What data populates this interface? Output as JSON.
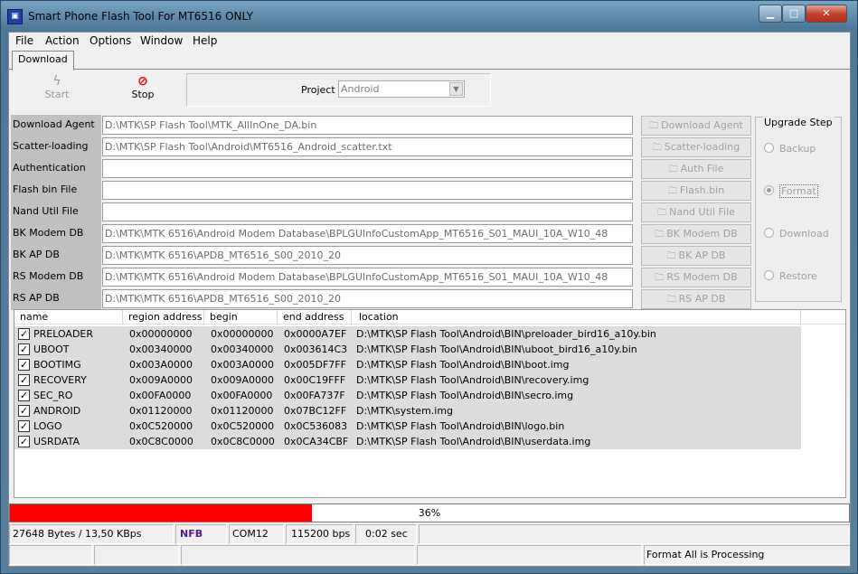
{
  "window": {
    "title": "Smart Phone Flash Tool For MT6516 ONLY",
    "min": "▁",
    "max": "□",
    "close": "✕"
  },
  "menu": [
    "File",
    "Action",
    "Options",
    "Window",
    "Help"
  ],
  "tabs": {
    "download": "Download"
  },
  "toolbar": {
    "start": "Start",
    "stop": "Stop",
    "project_label": "Project",
    "project_value": "Android"
  },
  "fields": [
    {
      "label": "Download Agent",
      "value": "D:\\MTK\\SP Flash Tool\\MTK_AllInOne_DA.bin",
      "button": "Download Agent"
    },
    {
      "label": "Scatter-loading File",
      "value": "D:\\MTK\\SP Flash Tool\\Android\\MT6516_Android_scatter.txt",
      "button": "Scatter-loading"
    },
    {
      "label": "Authentication File",
      "value": "",
      "button": "Auth File"
    },
    {
      "label": "Flash bin File",
      "value": "",
      "button": "Flash.bin"
    },
    {
      "label": "Nand Util File",
      "value": "",
      "button": "Nand Util File"
    },
    {
      "label": "BK Modem DB",
      "value": "D:\\MTK\\MTK 6516\\Android Modem Database\\BPLGUInfoCustomApp_MT6516_S01_MAUI_10A_W10_48",
      "button": "BK Modem DB"
    },
    {
      "label": "BK AP DB",
      "value": "D:\\MTK\\MTK 6516\\APDB_MT6516_S00_2010_20",
      "button": "BK AP DB"
    },
    {
      "label": "RS Modem DB",
      "value": "D:\\MTK\\MTK 6516\\Android Modem Database\\BPLGUInfoCustomApp_MT6516_S01_MAUI_10A_W10_48",
      "button": "RS Modem DB"
    },
    {
      "label": "RS AP DB",
      "value": "D:\\MTK\\MTK 6516\\APDB_MT6516_S00_2010_20",
      "button": "RS AP DB"
    }
  ],
  "upgrade": {
    "title": "Upgrade Step",
    "options": [
      "Backup",
      "Format",
      "Download",
      "Restore"
    ],
    "selected": "Format"
  },
  "table": {
    "headers": [
      "name",
      "region address",
      "begin address",
      "end address",
      "location"
    ],
    "rows": [
      {
        "name": "PRELOADER",
        "region": "0x00000000",
        "begin": "0x00000000",
        "end": "0x0000A7EF",
        "location": "D:\\MTK\\SP Flash Tool\\Android\\BIN\\preloader_bird16_a10y.bin"
      },
      {
        "name": "UBOOT",
        "region": "0x00340000",
        "begin": "0x00340000",
        "end": "0x003614C3",
        "location": "D:\\MTK\\SP Flash Tool\\Android\\BIN\\uboot_bird16_a10y.bin"
      },
      {
        "name": "BOOTIMG",
        "region": "0x003A0000",
        "begin": "0x003A0000",
        "end": "0x005DF7FF",
        "location": "D:\\MTK\\SP Flash Tool\\Android\\BIN\\boot.img"
      },
      {
        "name": "RECOVERY",
        "region": "0x009A0000",
        "begin": "0x009A0000",
        "end": "0x00C19FFF",
        "location": "D:\\MTK\\SP Flash Tool\\Android\\BIN\\recovery.img"
      },
      {
        "name": "SEC_RO",
        "region": "0x00FA0000",
        "begin": "0x00FA0000",
        "end": "0x00FA737F",
        "location": "D:\\MTK\\SP Flash Tool\\Android\\BIN\\secro.img"
      },
      {
        "name": "ANDROID",
        "region": "0x01120000",
        "begin": "0x01120000",
        "end": "0x07BC12FF",
        "location": "D:\\MTK\\system.img"
      },
      {
        "name": "LOGO",
        "region": "0x0C520000",
        "begin": "0x0C520000",
        "end": "0x0C536083",
        "location": "D:\\MTK\\SP Flash Tool\\Android\\BIN\\logo.bin"
      },
      {
        "name": "USRDATA",
        "region": "0x0C8C0000",
        "begin": "0x0C8C0000",
        "end": "0x0CA34CBF",
        "location": "D:\\MTK\\SP Flash Tool\\Android\\BIN\\userdata.img"
      }
    ]
  },
  "progress": {
    "value": 0.36,
    "label": "36%",
    "color": "#ff0000"
  },
  "status": {
    "bytes": "27648 Bytes / 13,50 KBps",
    "nfb": "NFB",
    "com": "COM12",
    "baud": "115200 bps",
    "time": "0:02 sec",
    "message": "Format All is Processing"
  },
  "colors": {
    "nfb": "#551a8b",
    "label_bg": "#c0c0c0",
    "row_bg": "#dcdcdc"
  },
  "icons": {
    "start": "flash-icon",
    "stop": "no-entry-icon",
    "folder": "folder-icon",
    "checkbox": "check-mark"
  }
}
